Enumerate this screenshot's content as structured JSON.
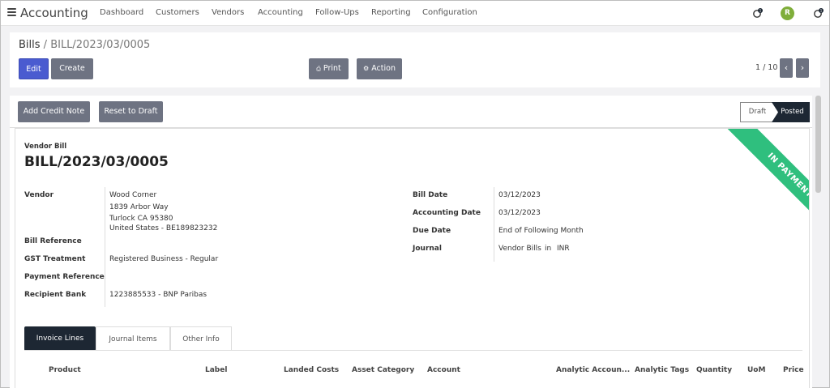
{
  "topbar": {
    "app_title": "Accounting",
    "menu": [
      "Dashboard",
      "Customers",
      "Vendors",
      "Accounting",
      "Follow-Ups",
      "Reporting",
      "Configuration"
    ],
    "notif_count_1": "1",
    "notif_count_2": "1",
    "avatar_initial": "R"
  },
  "control": {
    "breadcrumb_root": "Bills",
    "breadcrumb_sep": " / ",
    "breadcrumb_current": "BILL/2023/03/0005",
    "edit_label": "Edit",
    "create_label": "Create",
    "print_label": "Print",
    "action_label": "Action",
    "pager": "1 / 10"
  },
  "statusbar": {
    "add_credit_note_label": "Add Credit Note",
    "reset_to_draft_label": "Reset to Draft",
    "stages": [
      "Draft",
      "Posted"
    ],
    "active_stage": "Posted"
  },
  "form": {
    "ribbon": "IN PAYMENT",
    "doc_type": "Vendor Bill",
    "doc_name": "BILL/2023/03/0005",
    "vendor_label": "Vendor",
    "vendor_lines": [
      "Wood Corner",
      "1839 Arbor Way",
      "Turlock CA 95380",
      "United States - BE189823232"
    ],
    "bill_reference_label": "Bill Reference",
    "gst_treatment_label": "GST Treatment",
    "gst_treatment_value": "Registered Business - Regular",
    "payment_reference_label": "Payment Reference",
    "recipient_bank_label": "Recipient Bank",
    "recipient_bank_value": "1223885533 - BNP Paribas",
    "bill_date_label": "Bill Date",
    "bill_date_value": "03/12/2023",
    "accounting_date_label": "Accounting Date",
    "accounting_date_value": "03/12/2023",
    "due_date_label": "Due Date",
    "due_date_value": "End of Following Month",
    "journal_label": "Journal",
    "journal_value": "Vendor Bills",
    "journal_in": "in",
    "journal_currency": "INR"
  },
  "tabs": [
    "Invoice Lines",
    "Journal Items",
    "Other Info"
  ],
  "table_headers": [
    "Product",
    "Label",
    "Landed Costs",
    "Asset Category",
    "Account",
    "Analytic Accoun...",
    "Analytic Tags",
    "Quantity",
    "UoM",
    "Price"
  ],
  "colors": {
    "primary": "#4a5bd0",
    "secondary_button": "#6e7382",
    "dark": "#1d2733",
    "ribbon": "#2fbf7e",
    "avatar": "#7fae3a"
  }
}
